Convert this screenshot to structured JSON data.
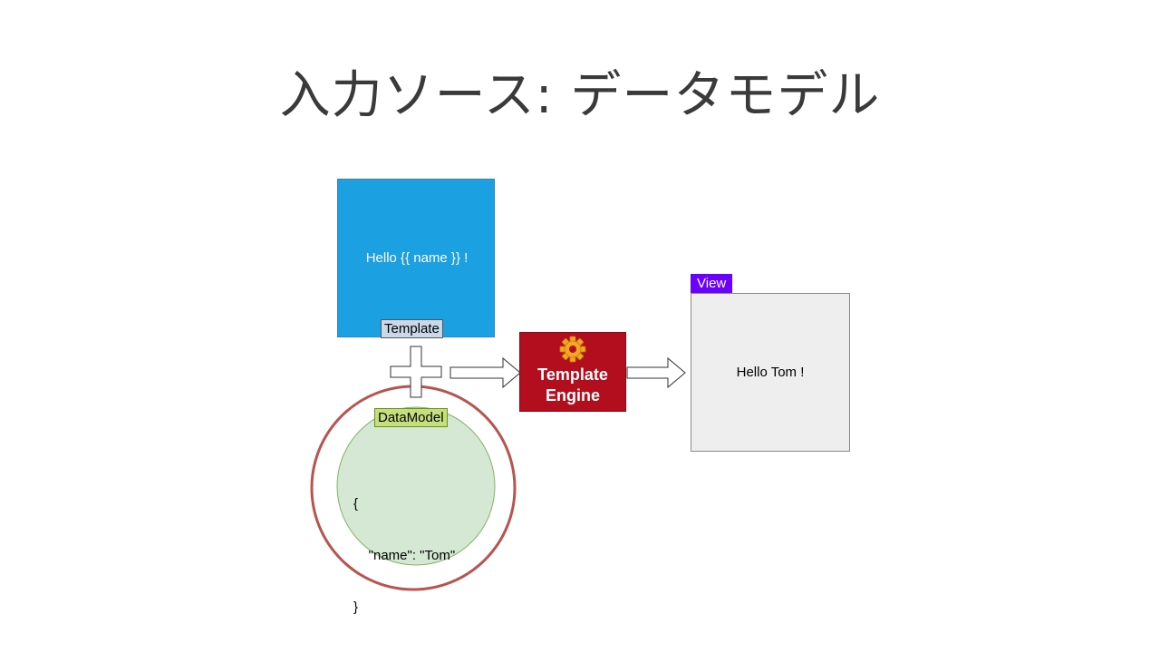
{
  "slide": {
    "title": "入力ソース: データモデル"
  },
  "template_node": {
    "content": "Hello {{ name }} !",
    "label": "Template",
    "color": "#1ba1e2"
  },
  "data_model_node": {
    "label": "DataModel",
    "code_lines": [
      "{",
      "    \"name\": \"Tom\"",
      "}"
    ],
    "fill_color": "#d5e8d4",
    "highlight_ring_color": "#b85450"
  },
  "engine_node": {
    "line1": "Template",
    "line2": "Engine",
    "color": "#b20e1e",
    "icon": "gear-icon"
  },
  "view_node": {
    "label": "View",
    "content": "Hello Tom !",
    "label_color": "#6a00ff"
  },
  "connectors": {
    "combine_icon": "plus-icon",
    "arrow_icon": "right-arrow-icon"
  }
}
